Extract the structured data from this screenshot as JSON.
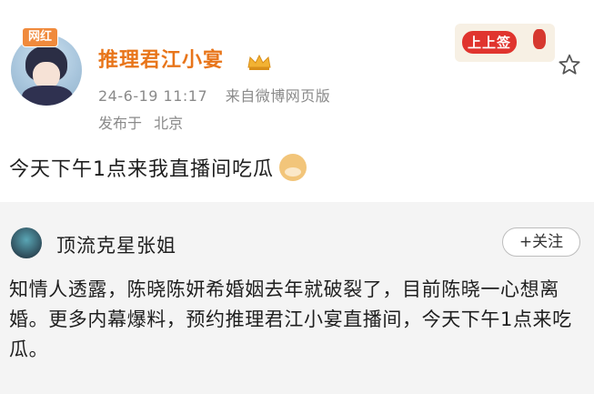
{
  "post": {
    "vip_badge": "网红",
    "username": "推理君江小宴",
    "date": "24-6-19 11:17",
    "source": "来自微博网页版",
    "location_prefix": "发布于",
    "location": "北京",
    "text": "今天下午1点来我直播间吃瓜",
    "banner_label": "上上签"
  },
  "repost": {
    "username": "顶流克星张姐",
    "follow_label": "+关注",
    "text": "知情人透露，陈晓陈妍希婚姻去年就破裂了，目前陈晓一心想离婚。更多内幕爆料，预约推理君江小宴直播间，今天下午1点来吃瓜。"
  },
  "colors": {
    "username": "#e8751a",
    "meta": "#8a8a8a",
    "repost_bg": "#f4f4f4"
  },
  "icons": {
    "crown": "crown-icon",
    "doge": "doge-emoji-icon",
    "star": "star-icon"
  }
}
